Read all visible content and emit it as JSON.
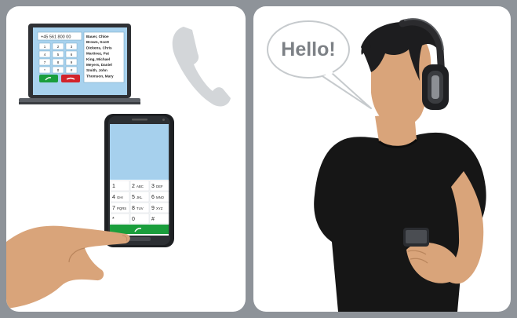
{
  "laptop": {
    "number": "+45 561 800 00",
    "keys": [
      "1",
      "2",
      "3",
      "4",
      "5",
      "6",
      "7",
      "8",
      "9",
      "*",
      "0",
      "#"
    ],
    "contacts": [
      "Bauer, Chloe",
      "Brown, Scott",
      "Dickens, Chris",
      "Martinez, Pat",
      "King, Michael",
      "Meyers, Daniel",
      "Smith, John",
      "Thomson, Mary"
    ]
  },
  "phone": {
    "keys": [
      {
        "digit": "1",
        "letters": ""
      },
      {
        "digit": "2",
        "letters": "ABC"
      },
      {
        "digit": "3",
        "letters": "DEF"
      },
      {
        "digit": "4",
        "letters": "GHI"
      },
      {
        "digit": "5",
        "letters": "JKL"
      },
      {
        "digit": "6",
        "letters": "MNO"
      },
      {
        "digit": "7",
        "letters": "PQRS"
      },
      {
        "digit": "8",
        "letters": "TUV"
      },
      {
        "digit": "9",
        "letters": "XYZ"
      },
      {
        "digit": "*",
        "letters": ""
      },
      {
        "digit": "0",
        "letters": ""
      },
      {
        "digit": "#",
        "letters": ""
      }
    ]
  },
  "speech": {
    "text": "Hello!"
  },
  "colors": {
    "background": "#8e9399",
    "panel": "#ffffff",
    "call_green": "#1a9e3c",
    "hangup_red": "#d2232a",
    "screen_blue": "#a9d3ef",
    "skin": "#d9a47a",
    "hair": "#1d1d1f",
    "shirt": "#161616"
  },
  "icons": [
    "phone-receiver-icon",
    "call-icon",
    "hangup-icon"
  ]
}
